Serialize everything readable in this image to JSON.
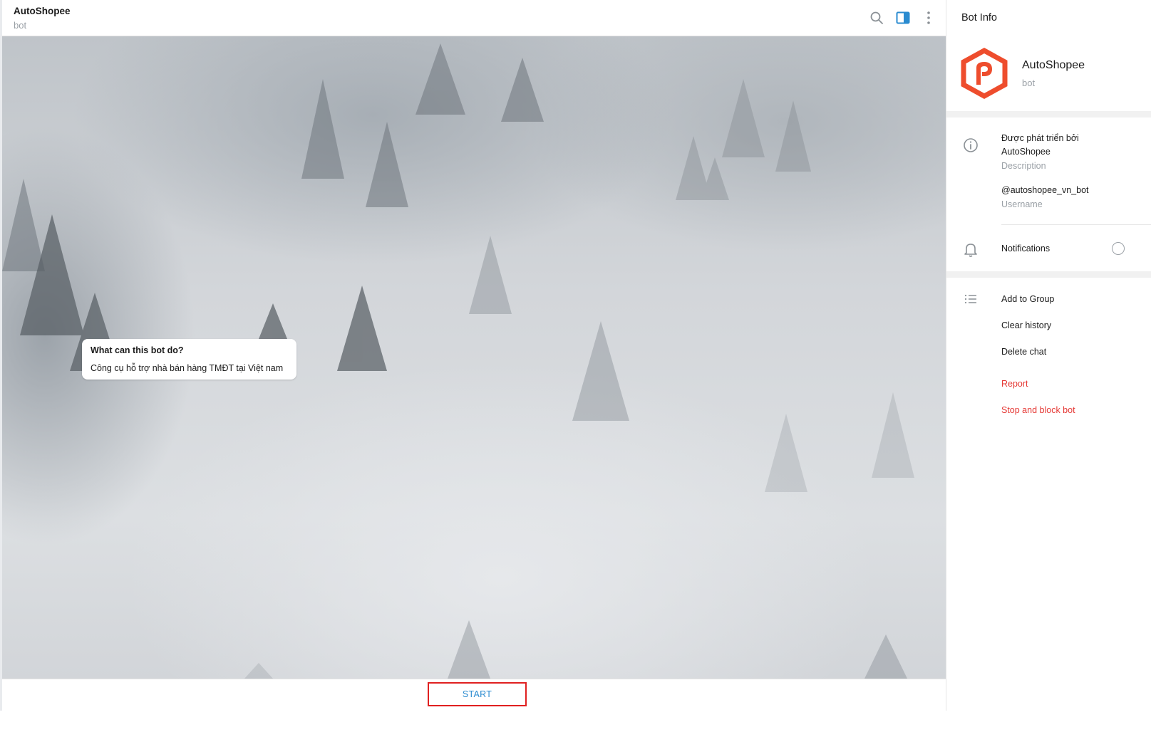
{
  "chat": {
    "title": "AutoShopee",
    "subtitle": "bot",
    "header_icons": [
      "search-icon",
      "sidebar-toggle-icon",
      "more-vertical-icon"
    ],
    "bot_card": {
      "title": "What can this bot do?",
      "text": "Công cụ hỗ trợ nhà bán hàng TMĐT tại Việt nam"
    },
    "start_label": "START"
  },
  "info": {
    "panel_title": "Bot Info",
    "name": "AutoShopee",
    "subtitle": "bot",
    "description_line1": "Được phát triển bởi",
    "description_line2": "AutoShopee",
    "description_label": "Description",
    "username": "@autoshopee_vn_bot",
    "username_label": "Username",
    "notifications_label": "Notifications",
    "actions": {
      "add_to_group": "Add to Group",
      "clear_history": "Clear history",
      "delete_chat": "Delete chat",
      "report": "Report",
      "stop_block": "Stop and block bot"
    }
  },
  "colors": {
    "accent": "#2a8bd0",
    "danger": "#e53935",
    "brand_logo": "#ee4d2d",
    "highlight_border": "#e02020"
  }
}
